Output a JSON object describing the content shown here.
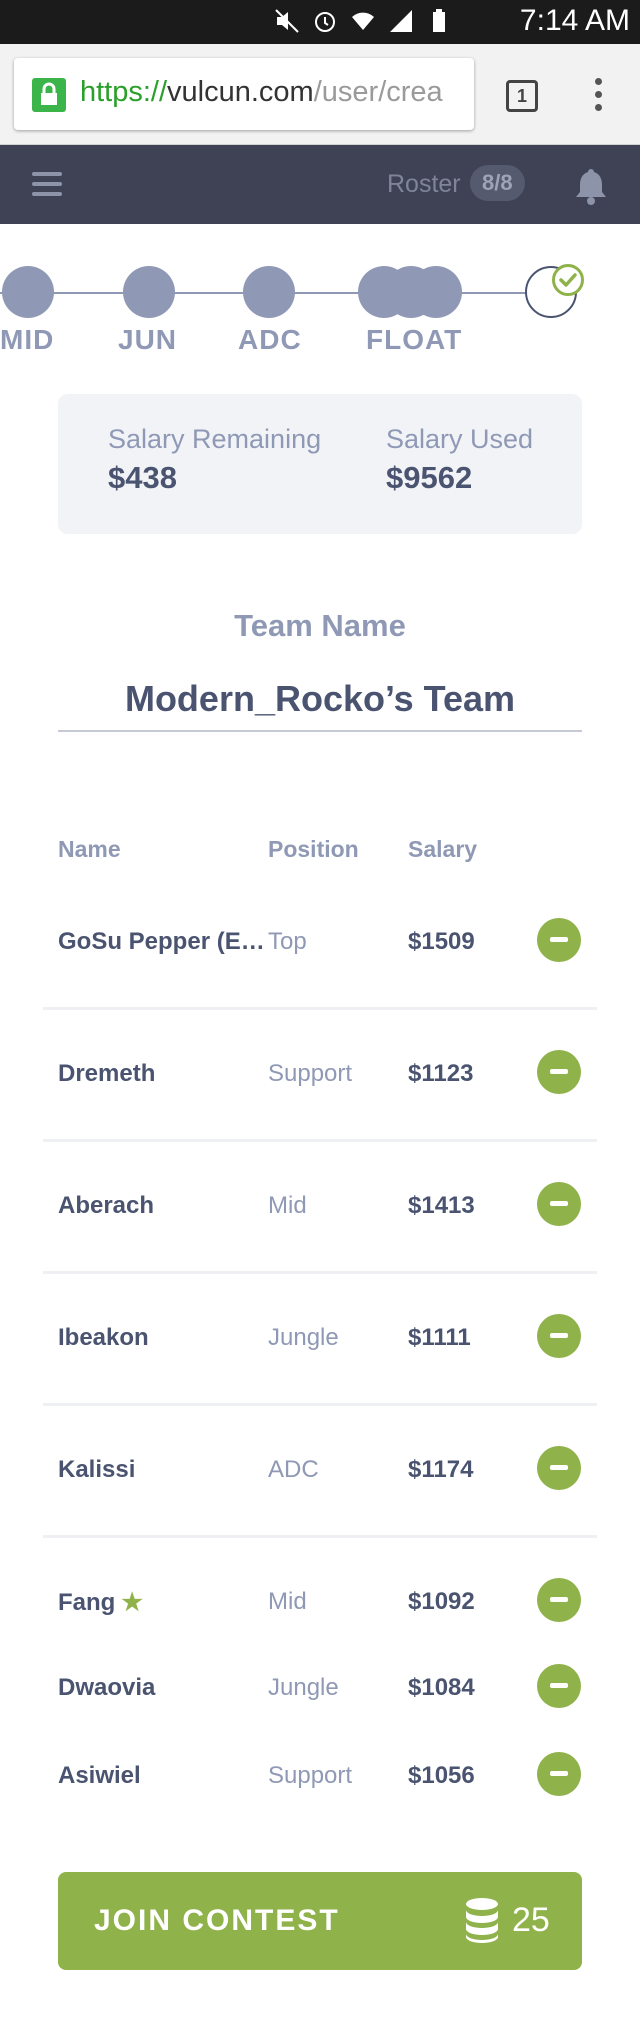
{
  "status_bar": {
    "time": "7:14 AM"
  },
  "browser": {
    "url_scheme": "https://",
    "url_host": "vulcun.com",
    "url_path": "/user/crea",
    "tab_count": "1"
  },
  "header": {
    "roster_label": "Roster",
    "roster_count": "8/8"
  },
  "steps": [
    "MID",
    "JUN",
    "ADC",
    "FLOAT"
  ],
  "salary": {
    "remaining_label": "Salary Remaining",
    "remaining_value": "$438",
    "used_label": "Salary Used",
    "used_value": "$9562"
  },
  "team": {
    "label": "Team Name",
    "value": "Modern_Rocko’s Team"
  },
  "table": {
    "headers": {
      "name": "Name",
      "position": "Position",
      "salary": "Salary"
    },
    "rows": [
      {
        "name": "GoSu Pepper (E…",
        "position": "Top",
        "salary": "$1509"
      },
      {
        "name": "Dremeth",
        "position": "Support",
        "salary": "$1123"
      },
      {
        "name": "Aberach",
        "position": "Mid",
        "salary": "$1413"
      },
      {
        "name": "Ibeakon",
        "position": "Jungle",
        "salary": "$1111"
      },
      {
        "name": "Kalissi",
        "position": "ADC",
        "salary": "$1174"
      },
      {
        "name": "Fang",
        "position": "Mid",
        "salary": "$1092",
        "starred": true
      },
      {
        "name": "Dwaovia",
        "position": "Jungle",
        "salary": "$1084"
      },
      {
        "name": "Asiwiel",
        "position": "Support",
        "salary": "$1056"
      }
    ]
  },
  "join": {
    "label": "JOIN CONTEST",
    "cost": "25"
  },
  "icons": {
    "star": "★",
    "accent": "#8fb24a",
    "header_bg": "#3f4254",
    "muted": "#8f99b5",
    "text": "#4a5470"
  }
}
